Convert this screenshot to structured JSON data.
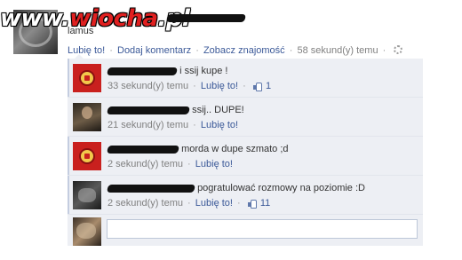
{
  "post": {
    "text": "lamus",
    "actions": {
      "like": "Lubię to!",
      "comment": "Dodaj komentarz",
      "friendship": "Zobacz znajomość",
      "timestamp": "58 sekund(y) temu",
      "separator": "·"
    }
  },
  "watermark": {
    "prefix": "www.",
    "brand": "wiocha",
    "suffix": ".pl"
  },
  "comments": [
    {
      "text": "i ssij kupe !",
      "timestamp": "33 sekund(y) temu",
      "like": "Lubię to!",
      "likes": "1",
      "avatar": "red-crest"
    },
    {
      "text": "ssij.. DUPE!",
      "timestamp": "21 sekund(y) temu",
      "like": "Lubię to!",
      "avatar": "dark-photo"
    },
    {
      "text": "morda w dupe szmato ;d",
      "timestamp": "2 sekund(y) temu",
      "like": "Lubię to!",
      "avatar": "red-crest"
    },
    {
      "text": "pogratulować rozmowy na poziomie :D",
      "timestamp": "2 sekund(y) temu",
      "like": "Lubię to!",
      "likes": "11",
      "avatar": "gray-photo"
    }
  ],
  "reply": {
    "value": ""
  },
  "colors": {
    "link": "#3b5998",
    "comment_bg": "#edeff4",
    "meta": "#808080",
    "watermark_brand": "#e02020"
  },
  "icons": {
    "like": "thumbs-up-icon",
    "settings": "gear-icon"
  }
}
